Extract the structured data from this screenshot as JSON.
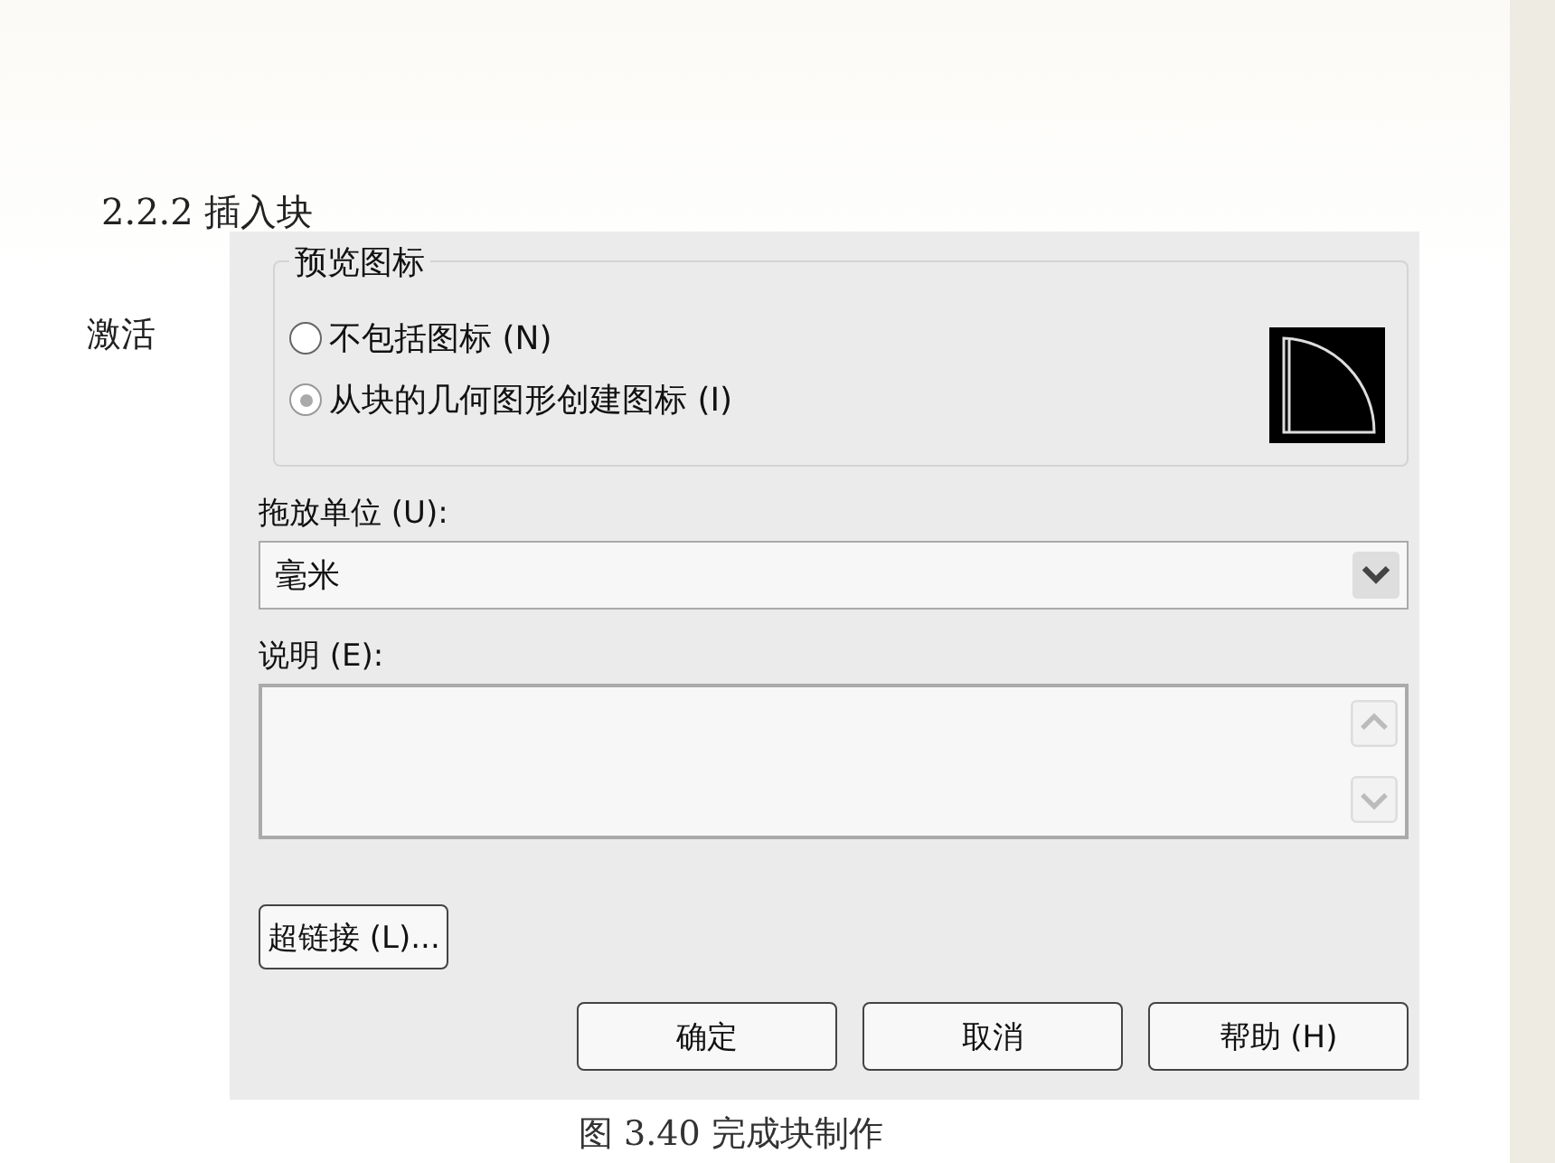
{
  "heading": "2.2.2 插入块",
  "side_label": "激活",
  "dialog": {
    "preview_group": {
      "title": "预览图标",
      "options": [
        {
          "label": "不包括图标 (N)",
          "selected": false
        },
        {
          "label": "从块的几何图形创建图标 (I)",
          "selected": true
        }
      ]
    },
    "units": {
      "label": "拖放单位 (U):",
      "value": "毫米"
    },
    "description": {
      "label": "说明 (E):"
    },
    "hyperlink_button": "超链接 (L)...",
    "buttons": [
      "确定",
      "取消",
      "帮助 (H)"
    ]
  },
  "caption": "图 3.40 完成块制作"
}
